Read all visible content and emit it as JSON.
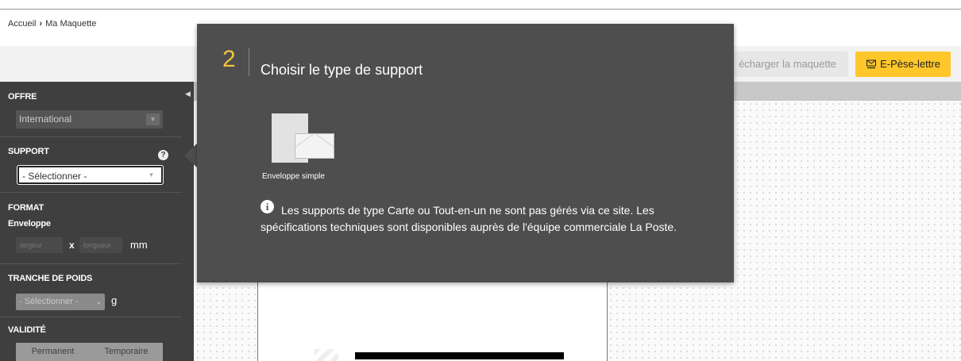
{
  "breadcrumb": {
    "home": "Accueil",
    "separator": "›",
    "current": "Ma Maquette"
  },
  "toolbar": {
    "download_label": "écharger la maquette",
    "pese_label": "E-Pèse-lettre",
    "pese_icon": "letter-scale-icon",
    "pese_color": "#ffc72a"
  },
  "sidebar": {
    "offre": {
      "title": "OFFRE",
      "value": "International"
    },
    "support": {
      "title": "SUPPORT",
      "value": "- Sélectionner -",
      "help": "?"
    },
    "format": {
      "title": "FORMAT",
      "subtitle": "Enveloppe",
      "width_placeholder": "largeur",
      "times": "x",
      "length_placeholder": "longueur",
      "unit": "mm"
    },
    "poids": {
      "title": "TRANCHE DE POIDS",
      "value": "- Sélectionner -",
      "unit": "g"
    },
    "validite": {
      "title": "VALIDITÉ",
      "options": [
        "Permanent",
        "Temporaire"
      ]
    }
  },
  "popover": {
    "step": "2",
    "title": "Choisir le type de support",
    "options": [
      {
        "label": "Enveloppe simple",
        "icon": "envelope-icon"
      }
    ],
    "info_icon": "info-icon",
    "info": "Les supports de type Carte ou Tout-en-un ne sont pas gérés via ce site. Les spécifications techniques sont disponibles auprès de l'équipe commerciale La Poste.",
    "accent_color": "#f5c33b"
  }
}
